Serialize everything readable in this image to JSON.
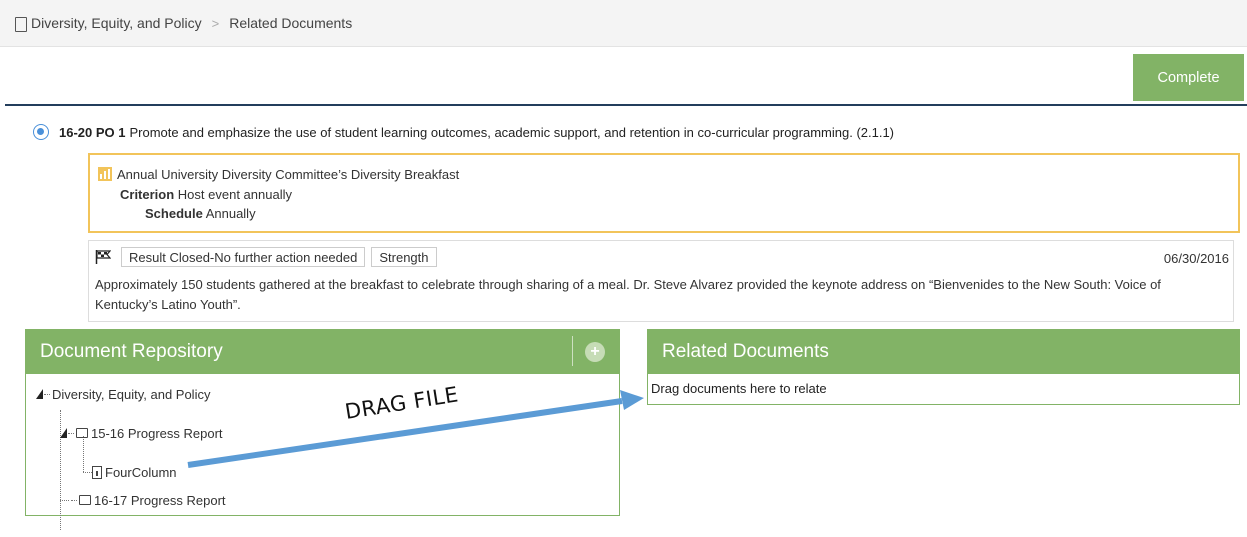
{
  "breadcrumb": {
    "items": [
      "Diversity, Equity, and Policy",
      "Related Documents"
    ]
  },
  "toolbar": {
    "complete_label": "Complete"
  },
  "objective": {
    "code": "16-20 PO 1",
    "text": "Promote and emphasize the use of student learning outcomes, academic support, and retention in co-curricular programming. (2.1.1)"
  },
  "measure": {
    "title": "Annual University Diversity Committee’s Diversity Breakfast",
    "criterion_label": "Criterion",
    "criterion_value": "Host event annually",
    "schedule_label": "Schedule",
    "schedule_value": "Annually"
  },
  "result": {
    "status": "Result Closed-No further action needed",
    "tag": "Strength",
    "date": "06/30/2016",
    "body": "Approximately 150 students gathered at the breakfast to celebrate through sharing of a meal. Dr. Steve Alvarez provided the keynote address on “Bienvenides to the New South: Voice of Kentucky’s Latino Youth”."
  },
  "repository": {
    "title": "Document Repository",
    "tree": {
      "root": "Diversity, Equity, and Policy",
      "folder1": "15-16 Progress Report",
      "file1": "FourColumn",
      "folder2": "16-17 Progress Report"
    }
  },
  "related": {
    "title": "Related Documents",
    "hint": "Drag documents here to relate"
  },
  "annotation": {
    "drag_label": "DRAG FILE",
    "arrow_color": "#5b9bd5"
  },
  "colors": {
    "accent_green": "#82b366",
    "measure_border": "#f2c45a",
    "header_rule": "#233e5c",
    "target_blue": "#4a90d9"
  }
}
